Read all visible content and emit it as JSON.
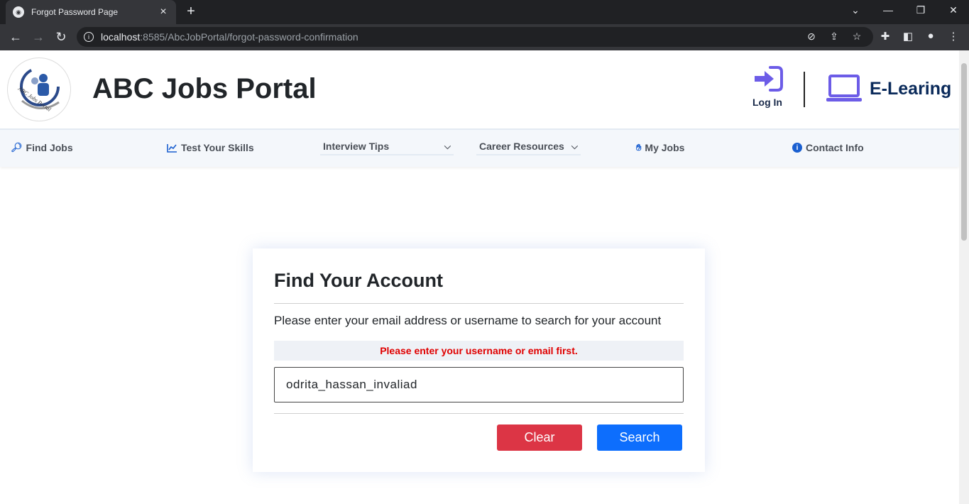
{
  "browser": {
    "tab_title": "Forgot Password Page",
    "url_host": "localhost",
    "url_rest": ":8585/AbcJobPortal/forgot-password-confirmation"
  },
  "header": {
    "title": "ABC Jobs Portal",
    "logo_text": "ABC Jobs Portal",
    "login_label": "Log In",
    "elearning_label": "E-Learing"
  },
  "nav": {
    "find_jobs": "Find Jobs",
    "test_skills": "Test Your Skills",
    "interview_tips": "Interview Tips",
    "career_resources": "Career Resources",
    "my_jobs": "My Jobs",
    "contact_info": "Contact Info"
  },
  "card": {
    "title": "Find Your Account",
    "description": "Please enter your email address or username to search for your account",
    "error": "Please enter your username or email first.",
    "input_value": "odrita_hassan_invaliad",
    "clear_label": "Clear",
    "search_label": "Search"
  },
  "colors": {
    "accent_purple": "#6c5ce7",
    "error_red": "#e00000",
    "clear_button": "#dc3545",
    "search_button": "#0d6efd"
  }
}
